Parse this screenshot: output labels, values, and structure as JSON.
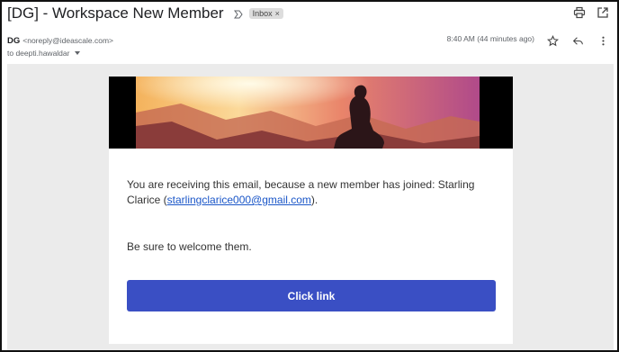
{
  "email": {
    "subject": "[DG] - Workspace New Member",
    "label": "Inbox",
    "label_close": "×",
    "sender_name": "DG",
    "sender_email": "<noreply@ideascale.com>",
    "time": "8:40 AM (44 minutes ago)",
    "to_text": "to deepti.hawaldar"
  },
  "message": {
    "line1_prefix": "You are receiving this email, because a new member has joined: Starling Clarice (",
    "member_email": "starlingclarice000@gmail.com",
    "line1_suffix": ").",
    "line2": "Be sure to welcome them.",
    "button_label": "Click link"
  }
}
